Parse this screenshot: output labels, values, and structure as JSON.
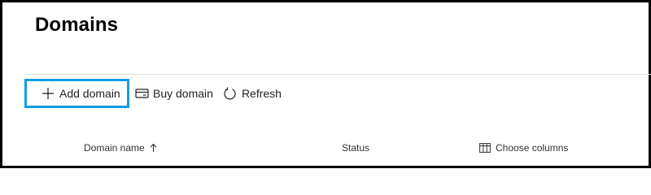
{
  "page": {
    "title": "Domains"
  },
  "toolbar": {
    "add_domain_label": "Add domain",
    "buy_domain_label": "Buy domain",
    "refresh_label": "Refresh"
  },
  "table": {
    "columns": [
      "Domain name",
      "Status"
    ],
    "choose_columns_label": "Choose columns",
    "sort": {
      "column": "Domain name",
      "direction": "ascending"
    }
  },
  "colors": {
    "highlight": "#0f9fe3",
    "frame": "#000000"
  },
  "icons": {
    "add": "plus-icon",
    "buy": "card-icon",
    "refresh": "refresh-icon",
    "sort": "arrow-up-icon",
    "columns": "columns-icon"
  }
}
